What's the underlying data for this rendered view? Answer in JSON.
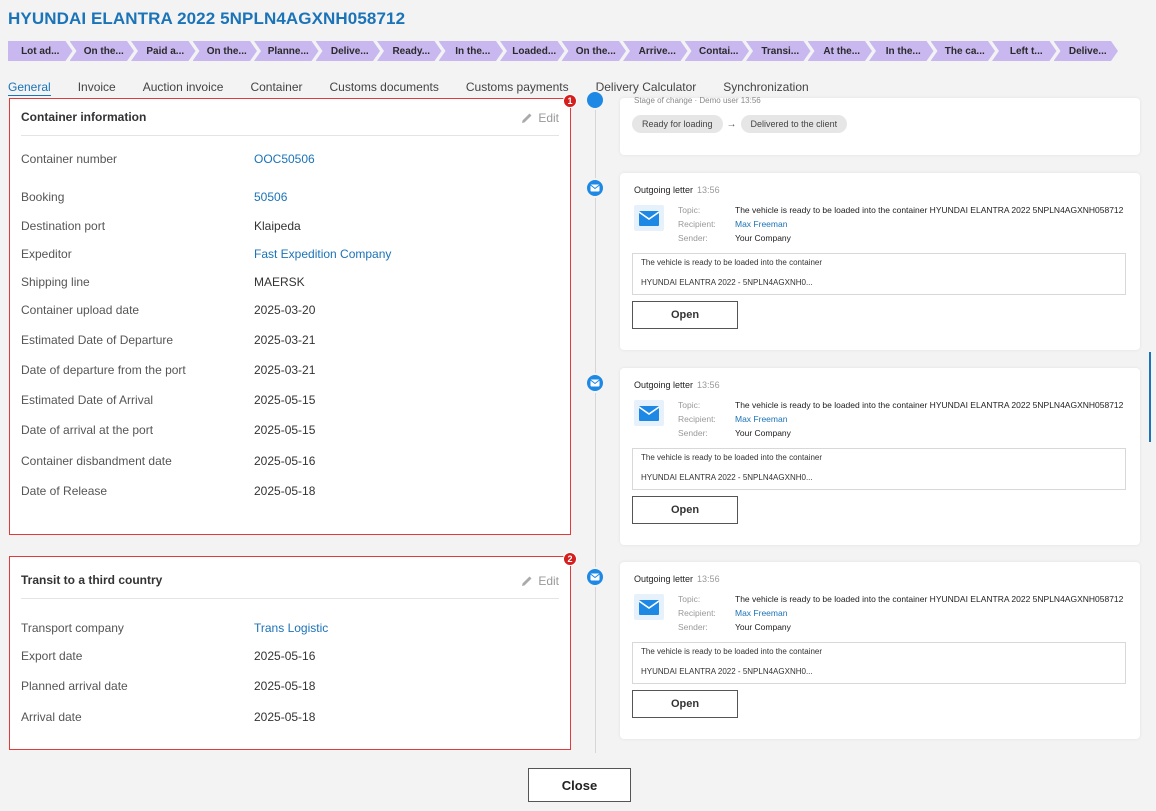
{
  "title": "HYUNDAI ELANTRA 2022 5NPLN4AGXNH058712",
  "stages": [
    "Lot ad...",
    "On the...",
    "Paid a...",
    "On the...",
    "Planne...",
    "Delive...",
    "Ready...",
    "In the...",
    "Loaded...",
    "On the...",
    "Arrive...",
    "Contai...",
    "Transi...",
    "At the...",
    "In the...",
    "The ca...",
    "Left t...",
    "Delive..."
  ],
  "tabs": [
    "General",
    "Invoice",
    "Auction invoice",
    "Container",
    "Customs documents",
    "Customs payments",
    "Delivery Calculator",
    "Synchronization"
  ],
  "container_card": {
    "badge": "1",
    "title": "Container information",
    "edit_label": "Edit",
    "rows": [
      {
        "label": "Container number",
        "value": "OOC50506"
      },
      {
        "label": "Booking",
        "value": "50506"
      },
      {
        "label": "Destination port",
        "value": "Klaipeda"
      },
      {
        "label": "Expeditor",
        "value": "Fast Expedition Company"
      },
      {
        "label": "Shipping line",
        "value": "MAERSK"
      },
      {
        "label": "Container upload date",
        "value": "2025-03-20"
      },
      {
        "label": "Estimated Date of Departure",
        "value": "2025-03-21"
      },
      {
        "label": "Date of departure from the port",
        "value": "2025-03-21"
      },
      {
        "label": "Estimated Date of Arrival",
        "value": "2025-05-15"
      },
      {
        "label": "Date of arrival at the port",
        "value": "2025-05-15"
      },
      {
        "label": "Container disbandment date",
        "value": "2025-05-16"
      },
      {
        "label": "Date of Release",
        "value": "2025-05-18"
      }
    ]
  },
  "transit_card": {
    "badge": "2",
    "title": "Transit to a third country",
    "edit_label": "Edit",
    "rows": [
      {
        "label": "Transport company",
        "value": "Trans Logistic"
      },
      {
        "label": "Export date",
        "value": "2025-05-16"
      },
      {
        "label": "Planned arrival date",
        "value": "2025-05-18"
      },
      {
        "label": "Arrival date",
        "value": "2025-05-18"
      }
    ]
  },
  "timeline": {
    "stage_change": {
      "cut_label": "Stage of change · Demo user 13:56",
      "from": "Ready for loading",
      "arrow": "→",
      "to": "Delivered to the client"
    },
    "letters": [
      {
        "type": "Outgoing letter",
        "time": "13:56",
        "topic_label": "Topic:",
        "topic": "The vehicle is ready to be loaded into the container HYUNDAI ELANTRA 2022 5NPLN4AGXNH058712",
        "recipient_label": "Recipient:",
        "recipient": "Max Freeman",
        "sender_label": "Sender:",
        "sender": "Your Company",
        "preview_line1": "The vehicle is ready to be loaded into the container",
        "preview_line2": "HYUNDAI ELANTRA 2022 - 5NPLN4AGXNH0...",
        "open_label": "Open"
      },
      {
        "type": "Outgoing letter",
        "time": "13:56",
        "topic_label": "Topic:",
        "topic": "The vehicle is ready to be loaded into the container HYUNDAI ELANTRA 2022 5NPLN4AGXNH058712",
        "recipient_label": "Recipient:",
        "recipient": "Max Freeman",
        "sender_label": "Sender:",
        "sender": "Your Company",
        "preview_line1": "The vehicle is ready to be loaded into the container",
        "preview_line2": "HYUNDAI ELANTRA 2022 - 5NPLN4AGXNH0...",
        "open_label": "Open"
      },
      {
        "type": "Outgoing letter",
        "time": "13:56",
        "topic_label": "Topic:",
        "topic": "The vehicle is ready to be loaded into the container HYUNDAI ELANTRA 2022 5NPLN4AGXNH058712",
        "recipient_label": "Recipient:",
        "recipient": "Max Freeman",
        "sender_label": "Sender:",
        "sender": "Your Company",
        "preview_line1": "The vehicle is ready to be loaded into the container",
        "preview_line2": "HYUNDAI ELANTRA 2022 - 5NPLN4AGXNH0...",
        "open_label": "Open"
      }
    ]
  },
  "close_label": "Close",
  "colors": {
    "accent": "#1b73b8",
    "stage": "#c9b8f0",
    "badge": "#d51e1e",
    "highlight_border": "#e03a3a",
    "timeline_dot": "#1e88e5"
  }
}
